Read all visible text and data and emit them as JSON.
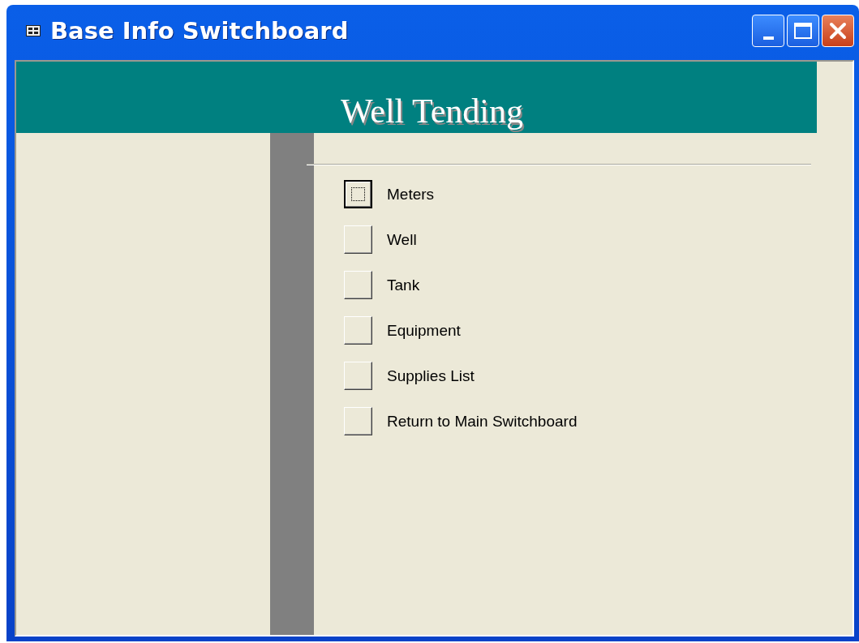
{
  "window": {
    "title": "Base Info Switchboard"
  },
  "header": {
    "title": "Well Tending"
  },
  "items": [
    {
      "label": "Meters",
      "selected": true
    },
    {
      "label": "Well",
      "selected": false
    },
    {
      "label": "Tank",
      "selected": false
    },
    {
      "label": "Equipment",
      "selected": false
    },
    {
      "label": "Supplies List",
      "selected": false
    },
    {
      "label": "Return to Main Switchboard",
      "selected": false
    }
  ]
}
